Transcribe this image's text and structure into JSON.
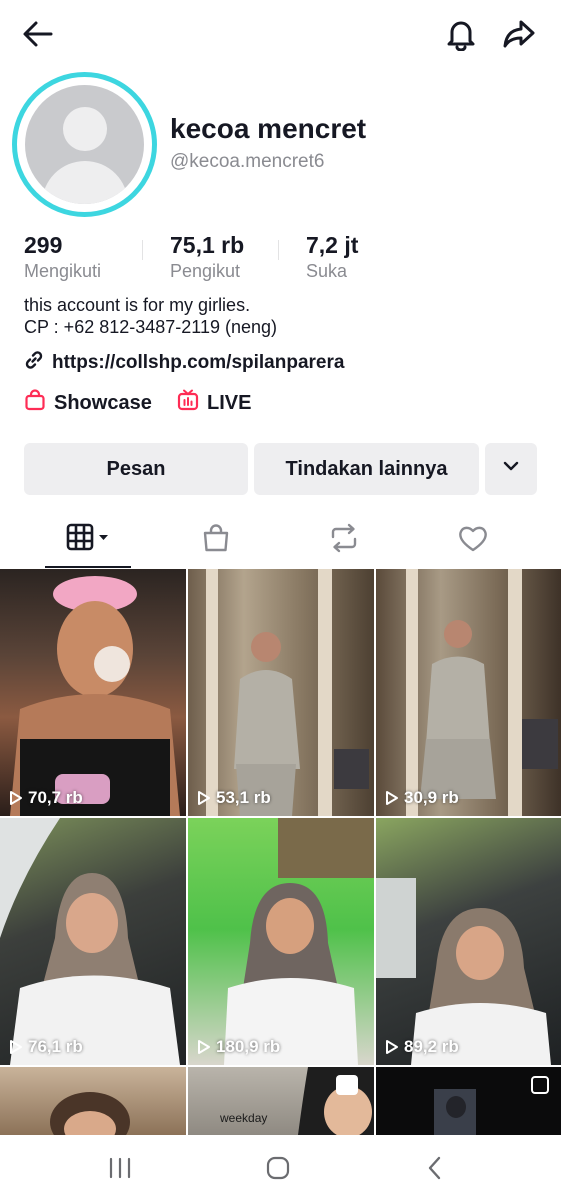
{
  "header": {
    "back_icon": "arrow-left-icon",
    "notification_icon": "bell-icon",
    "share_icon": "share-arrow-icon"
  },
  "profile": {
    "display_name": "kecoa mencret",
    "username": "@kecoa.mencret6",
    "avatar_ring_color": "#3dd6e0"
  },
  "stats": [
    {
      "value": "299",
      "label": "Mengikuti"
    },
    {
      "value": "75,1 rb",
      "label": "Pengikut"
    },
    {
      "value": "7,2 jt",
      "label": "Suka"
    }
  ],
  "bio": {
    "line1": "this account is for my girlies.",
    "line2": "CP : +62 812-3487-2119 (neng)"
  },
  "link": {
    "icon": "link-icon",
    "url": "https://collshp.com/spilanparera"
  },
  "chips": {
    "showcase_label": "Showcase",
    "live_label": "LIVE",
    "accent_color": "#fe2c55"
  },
  "actions": {
    "message_label": "Pesan",
    "more_label": "Tindakan lainnya",
    "dropdown_icon": "chevron-down-icon"
  },
  "tabs": [
    {
      "name": "grid",
      "icon": "grid-icon",
      "active": true
    },
    {
      "name": "shop",
      "icon": "shopping-bag-icon",
      "active": false
    },
    {
      "name": "reposts",
      "icon": "repost-icon",
      "active": false
    },
    {
      "name": "liked",
      "icon": "heart-icon",
      "active": false
    }
  ],
  "videos": [
    {
      "views": "70,7 rb"
    },
    {
      "views": "53,1 rb"
    },
    {
      "views": "30,9 rb"
    },
    {
      "views": "76,1 rb"
    },
    {
      "views": "180,9 rb"
    },
    {
      "views": "89,2 rb"
    },
    {
      "views": ""
    },
    {
      "views": "",
      "overlay_text": "weekday"
    },
    {
      "views": ""
    }
  ],
  "system_nav": {
    "recents_icon": "recents-icon",
    "home_icon": "home-icon",
    "back_icon": "back-chevron-icon"
  }
}
